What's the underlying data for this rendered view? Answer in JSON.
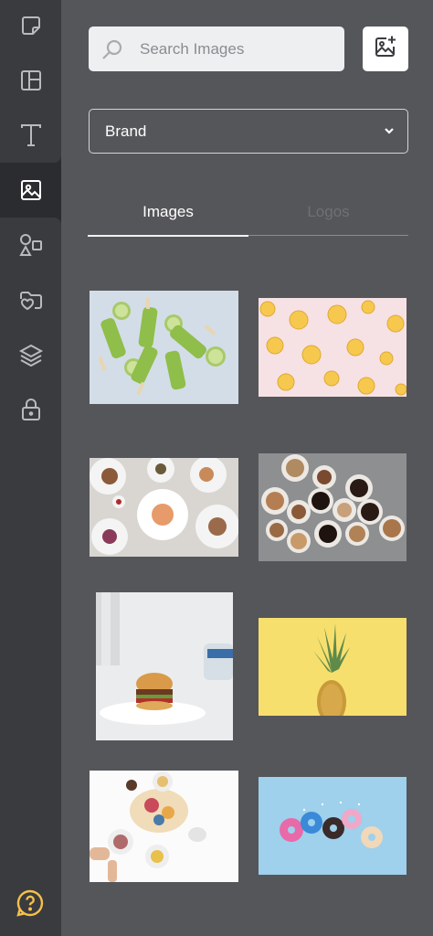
{
  "sidebar": {
    "items": [
      {
        "icon": "sticker-icon"
      },
      {
        "icon": "layout-icon"
      },
      {
        "icon": "text-icon"
      },
      {
        "icon": "image-icon",
        "active": true
      },
      {
        "icon": "shapes-icon"
      },
      {
        "icon": "folder-heart-icon"
      },
      {
        "icon": "layers-icon"
      },
      {
        "icon": "lock-icon"
      }
    ],
    "help_icon": "help-circle-icon",
    "accent_color": "#f5c04a"
  },
  "search": {
    "placeholder": "Search Images",
    "value": ""
  },
  "upload": {
    "icon": "image-add-icon"
  },
  "filter": {
    "selected": "Brand"
  },
  "tabs": [
    {
      "label": "Images",
      "active": true
    },
    {
      "label": "Logos",
      "active": false
    }
  ],
  "gallery": [
    {
      "subject": "green popsicles with limes"
    },
    {
      "subject": "pineapple slices on pink"
    },
    {
      "subject": "food plates flat lay"
    },
    {
      "subject": "coffee cups"
    },
    {
      "subject": "burger on plate"
    },
    {
      "subject": "pineapple on yellow"
    },
    {
      "subject": "breakfast table flat lay"
    },
    {
      "subject": "donuts on blue"
    }
  ]
}
